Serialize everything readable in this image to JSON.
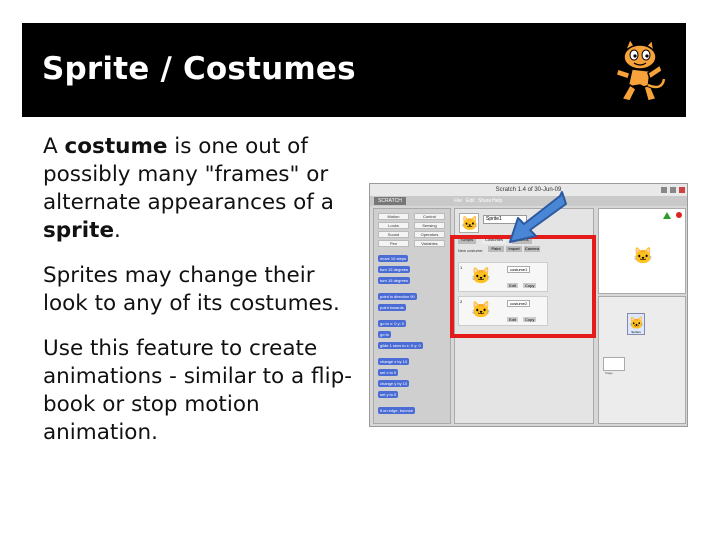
{
  "slide": {
    "title": "Sprite / Costumes",
    "paragraphs": [
      {
        "before": "A ",
        "bold": "costume",
        "after": " is one out of possibly many \"frames\" or alternate appearances of a "
      },
      {
        "before": "",
        "bold": "",
        "after": "Sprites may change their look to any of its costumes."
      },
      {
        "before": "",
        "bold": "",
        "after": "Use this feature to create animations - similar to a flip-book or stop motion animation."
      }
    ],
    "p1_bold2": "sprite",
    "p1_end": ".",
    "colors": {
      "title_bar": "#000000",
      "highlight_box": "#e31b1b",
      "arrow": "#4a86d6"
    },
    "icons": [
      "scratch-cat-logo-icon",
      "arrow-icon"
    ]
  },
  "screenshot": {
    "window_title": "Scratch 1.4 of 30-Jun-09",
    "logo": "SCRATCH",
    "menu": [
      "File",
      "Edit",
      "Share",
      "Help"
    ],
    "categories": [
      "Motion",
      "Control",
      "Looks",
      "Sensing",
      "Sound",
      "Operators",
      "Pen",
      "Variables"
    ],
    "blocks": [
      "move 10 steps",
      "turn 15 degrees",
      "turn 15 degrees",
      "point in direction 90",
      "point towards",
      "go to x: 0 y: 0",
      "go to",
      "glide 1 secs to x: 0 y: 0",
      "change x by 10",
      "set x to 0",
      "change y by 10",
      "set y to 0",
      "if on edge, bounce"
    ],
    "sprite_name": "Sprite1",
    "tabs": [
      "Scripts",
      "Costumes",
      "Sounds"
    ],
    "new_costume_label": "New costume:",
    "costume_buttons": [
      "Paint",
      "Import",
      "Camera"
    ],
    "costumes": [
      {
        "index": "1",
        "name": "costume1",
        "edit": "Edit",
        "copy": "Copy"
      },
      {
        "index": "2",
        "name": "costume2",
        "edit": "Edit",
        "copy": "Copy"
      }
    ],
    "sprite_list_item": "Sprite1",
    "stage_label": "Stage"
  }
}
